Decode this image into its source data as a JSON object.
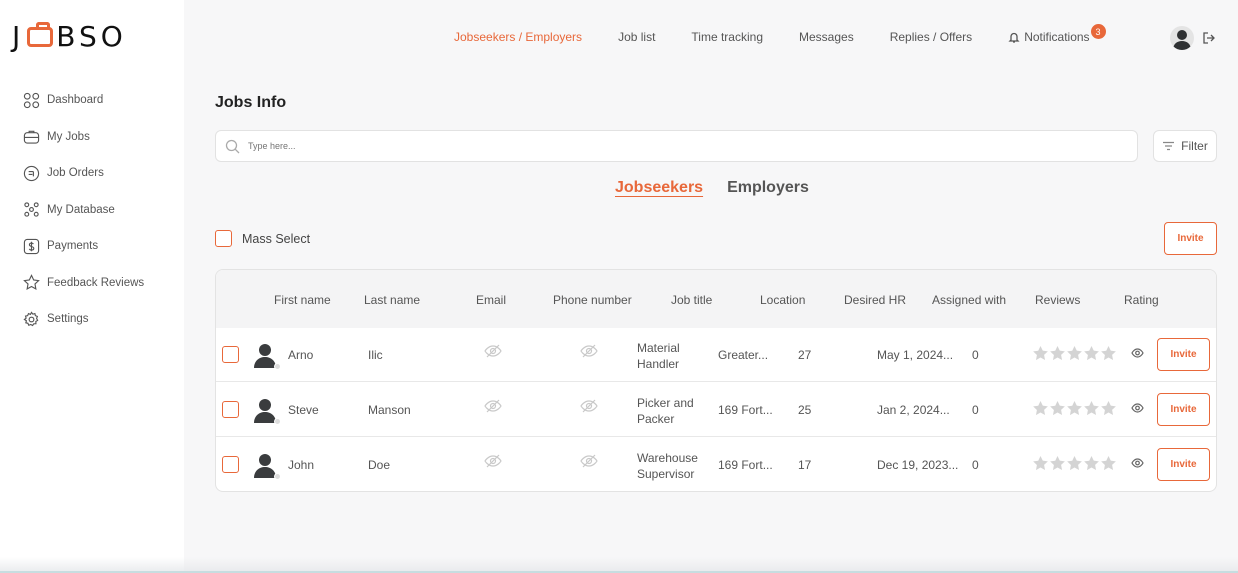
{
  "brand": {
    "logo_left": "J",
    "logo_right": "BSO",
    "accent": "#e8683a"
  },
  "sidebar": {
    "items": [
      {
        "label": "Dashboard",
        "icon": "grid-icon"
      },
      {
        "label": "My Jobs",
        "icon": "briefcase-icon"
      },
      {
        "label": "Job Orders",
        "icon": "order-icon"
      },
      {
        "label": "My Database",
        "icon": "database-icon"
      },
      {
        "label": "Payments",
        "icon": "dollar-icon"
      },
      {
        "label": "Feedback Reviews",
        "icon": "star-icon"
      },
      {
        "label": "Settings",
        "icon": "gear-icon"
      }
    ]
  },
  "topnav": {
    "links": [
      "Jobseekers / Employers",
      "Job list",
      "Time tracking",
      "Messages",
      "Replies / Offers"
    ],
    "notifications_label": "Notifications",
    "notifications_count": "3"
  },
  "page": {
    "title": "Jobs Info",
    "search_placeholder": "Type here...",
    "filter_label": "Filter",
    "tabs": [
      "Jobseekers",
      "Employers"
    ],
    "mass_select_label": "Mass Select",
    "invite_label": "Invite"
  },
  "table": {
    "headers": [
      "First name",
      "Last name",
      "Email",
      "Phone number",
      "Job title",
      "Location",
      "Desired HR",
      "Assigned with",
      "Reviews",
      "Rating"
    ],
    "rows": [
      {
        "first": "Arno",
        "last": "Ilic",
        "job1": "Material",
        "job2": "Handler",
        "location": "Greater...",
        "hr": "27",
        "assigned": "May 1, 2024...",
        "reviews": "0",
        "invite": "Invite"
      },
      {
        "first": "Steve",
        "last": "Manson",
        "job1": "Picker and",
        "job2": "Packer",
        "location": "169 Fort...",
        "hr": "25",
        "assigned": "Jan 2, 2024...",
        "reviews": "0",
        "invite": "Invite"
      },
      {
        "first": "John",
        "last": "Doe",
        "job1": "Warehouse",
        "job2": "Supervisor",
        "location": "169 Fort...",
        "hr": "17",
        "assigned": "Dec 19, 2023...",
        "reviews": "0",
        "invite": "Invite"
      }
    ]
  }
}
